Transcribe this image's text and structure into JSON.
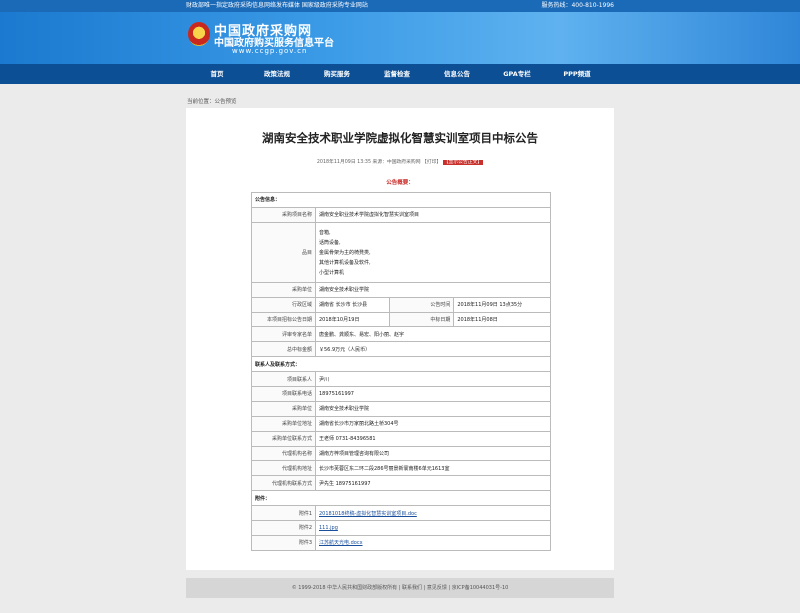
{
  "topbar": {
    "left_text": "财政部唯一指定政府采购信息网络发布媒体  国家级政府采购专业网站",
    "right_text": "服务热线：400-810-1996"
  },
  "site": {
    "name_cn": "中国政府采购网",
    "subtitle": "中国政府购买服务信息平台",
    "url": "www.ccgp.gov.cn"
  },
  "nav": [
    "首页",
    "政策法规",
    "购买服务",
    "监督检查",
    "信息公告",
    "GPA专栏",
    "PPP频道"
  ],
  "breadcrumb": "当前位置：公告预览",
  "notice": {
    "title": "湖南安全技术职业学院虚拟化智慧实训室项目中标公告",
    "meta": "2018年11月09日 13:35  来源：中国政府采购网  【打印】",
    "meta_tag": "【显示公告正文】",
    "overview_label": "公告概要："
  },
  "info": {
    "sec_announcement": "公告信息：",
    "project_name_label": "采购项目名称",
    "project_name": "湖南安全职业技术学院虚拟化智慧实训室项目",
    "items_label": "品目",
    "items": [
      "音箱,",
      "话筒设备,",
      "金属骨架为主的椅凳类,",
      "其他计算机设备及软件,",
      "小型计算机"
    ],
    "buyer_label": "采购单位",
    "buyer": "湖南安全技术职业学院",
    "region_label": "行政区域",
    "region": "湖南省 长沙市 长沙县",
    "publish_time_label": "公告时间",
    "publish_time": "2018年11月09日  13点35分",
    "bid_date_label": "本项目招标公告日期",
    "bid_date": "2018年10月19日",
    "award_date_label": "中标日期",
    "award_date": "2018年11月08日",
    "experts_label": "评审专家名单",
    "experts": "唐金鹏、龚顺东、易宏、阳小丽、赵宇",
    "amount_label": "总中标金额",
    "amount": "￥56.9万元（人民币）",
    "sec_contacts": "联系人及联系方式：",
    "contact_label": "项目联系人",
    "contact": "尹川",
    "contact_phone_label": "项目联系电话",
    "contact_phone": "18975161997",
    "buyer2_label": "采购单位",
    "buyer2": "湖南安全技术职业学院",
    "buyer_addr_label": "采购单位地址",
    "buyer_addr": "湖南省长沙市万家丽北路土桥304号",
    "buyer_contact_label": "采购单位联系方式",
    "buyer_contact": "王老师  0731-84396581",
    "agency_label": "代理机构名称",
    "agency": "湖南方梓项目管理咨询有限公司",
    "agency_addr_label": "代理机构地址",
    "agency_addr": "长沙市芙蓉区东二环二段286号丽景新寰南楼6单元1613室",
    "agency_contact_label": "代理机构联系方式",
    "agency_contact": "尹先生  18975161997",
    "sec_attachments": "附件：",
    "att1_label": "附件1",
    "att1": "20181018终稿-虚拟化智慧实训室项目.doc",
    "att2_label": "附件2",
    "att2": "111.jpg",
    "att3_label": "附件3",
    "att3": "江苏航天光电.docx"
  },
  "footer": "© 1999-2018  中华人民共和国财政部版权所有  |  联系我们  |  意见反馈  |  京ICP备10044031号-10"
}
